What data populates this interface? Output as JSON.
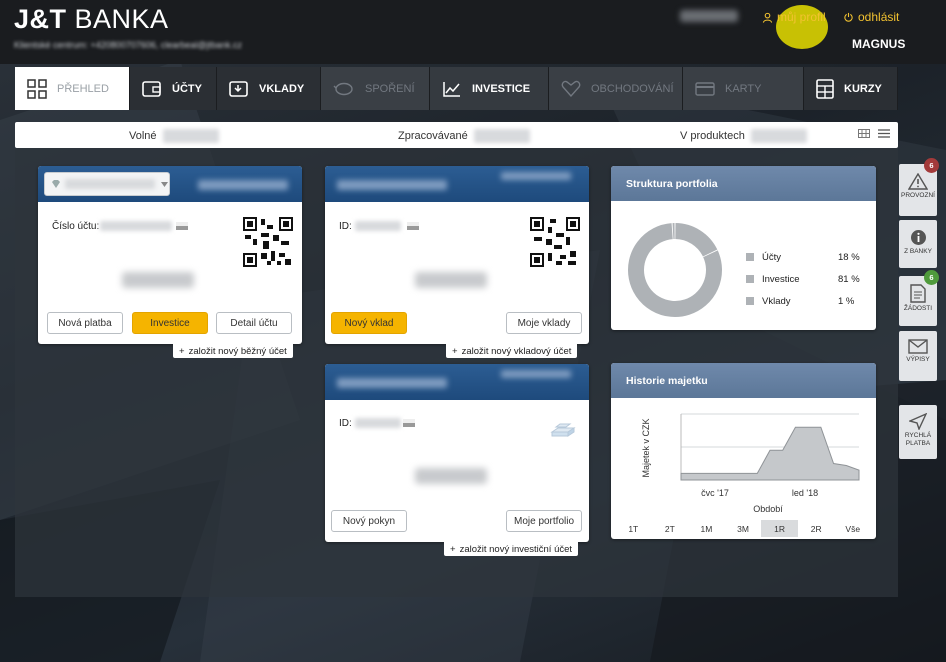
{
  "brand": {
    "logo_bold": "J&T",
    "logo_rest": " BANKA"
  },
  "header": {
    "contact": "Klientské centrum: +420800707606, clearbeal@jtbank.cz",
    "profile_link": "můj profil",
    "logout_link": "odhlásit",
    "username": "MAGNUS"
  },
  "nav": {
    "items": [
      {
        "label": "PŘEHLED",
        "icon": "grid-icon"
      },
      {
        "label": "ÚČTY",
        "icon": "wallet-icon"
      },
      {
        "label": "VKLADY",
        "icon": "deposit-icon"
      },
      {
        "label": "SPOŘENÍ",
        "icon": "piggybank-icon"
      },
      {
        "label": "INVESTICE",
        "icon": "chart-line-icon"
      },
      {
        "label": "OBCHODOVÁNÍ",
        "icon": "diamond-heart-icon"
      },
      {
        "label": "KARTY",
        "icon": "card-icon"
      },
      {
        "label": "KURZY",
        "icon": "calculator-icon"
      }
    ]
  },
  "summary": {
    "free_label": "Volné",
    "processing_label": "Zpracovávané",
    "products_label": "V produktech"
  },
  "account_card": {
    "number_label": "Číslo účtu:",
    "buttons": {
      "new_payment": "Nová platba",
      "investment": "Investice",
      "detail": "Detail účtu"
    },
    "add_link": "založit nový běžný účet"
  },
  "deposit_card": {
    "id_label": "ID:",
    "buttons": {
      "new_deposit": "Nový vklad",
      "my_deposits": "Moje vklady"
    },
    "add_link": "založit nový vkladový účet"
  },
  "investment_card": {
    "id_label": "ID:",
    "buttons": {
      "new_order": "Nový pokyn",
      "my_portfolio": "Moje portfolio"
    },
    "add_link": "založit nový investiční účet"
  },
  "portfolio": {
    "title": "Struktura portfolia",
    "legend": [
      {
        "label": "Účty",
        "value": "18 %"
      },
      {
        "label": "Investice",
        "value": "81 %"
      },
      {
        "label": "Vklady",
        "value": "1 %"
      }
    ]
  },
  "history": {
    "title": "Historie majetku",
    "ylabel": "Majetek v CZK",
    "xlabel": "Období",
    "ticks": [
      "čvc '17",
      "led '18"
    ],
    "ranges": [
      "1T",
      "2T",
      "1M",
      "3M",
      "1R",
      "2R",
      "Vše"
    ],
    "selected_range": "1R"
  },
  "sidebar": {
    "items": [
      {
        "label": "PROVOZNÍ",
        "icon": "warning-icon",
        "badge": "6"
      },
      {
        "label": "Z BANKY",
        "icon": "info-icon",
        "badge": ""
      },
      {
        "label": "ŽÁDOSTI",
        "icon": "document-icon",
        "badge": "6"
      },
      {
        "label": "VÝPISY",
        "icon": "envelope-icon",
        "badge": ""
      },
      {
        "label_line1": "RYCHLÁ",
        "label_line2": "PLATBA",
        "icon": "send-icon",
        "badge": ""
      }
    ]
  },
  "chart_data": [
    {
      "type": "pie",
      "title": "Struktura portfolia",
      "categories": [
        "Účty",
        "Investice",
        "Vklady"
      ],
      "values": [
        18,
        81,
        1
      ],
      "colors": [
        "#aeb2b6",
        "#aeb2b6",
        "#aeb2b6"
      ]
    },
    {
      "type": "area",
      "title": "Historie majetku",
      "xlabel": "Období",
      "ylabel": "Majetek v CZK",
      "x": [
        "čvc '17",
        "led '18"
      ],
      "series": [
        {
          "values": [
            0.1,
            0.1,
            0.1,
            0.1,
            0.1,
            0.1,
            0.1,
            0.45,
            0.45,
            0.8,
            0.8,
            0.8,
            0.25,
            0.22,
            0.15
          ]
        }
      ],
      "grid": true
    }
  ],
  "colors": {
    "accent": "#f5b400",
    "card_header": "#1e4a7c",
    "widget_header": "#6380a2",
    "badge": "#a33a3a",
    "badge_green": "#4f9a3c"
  }
}
